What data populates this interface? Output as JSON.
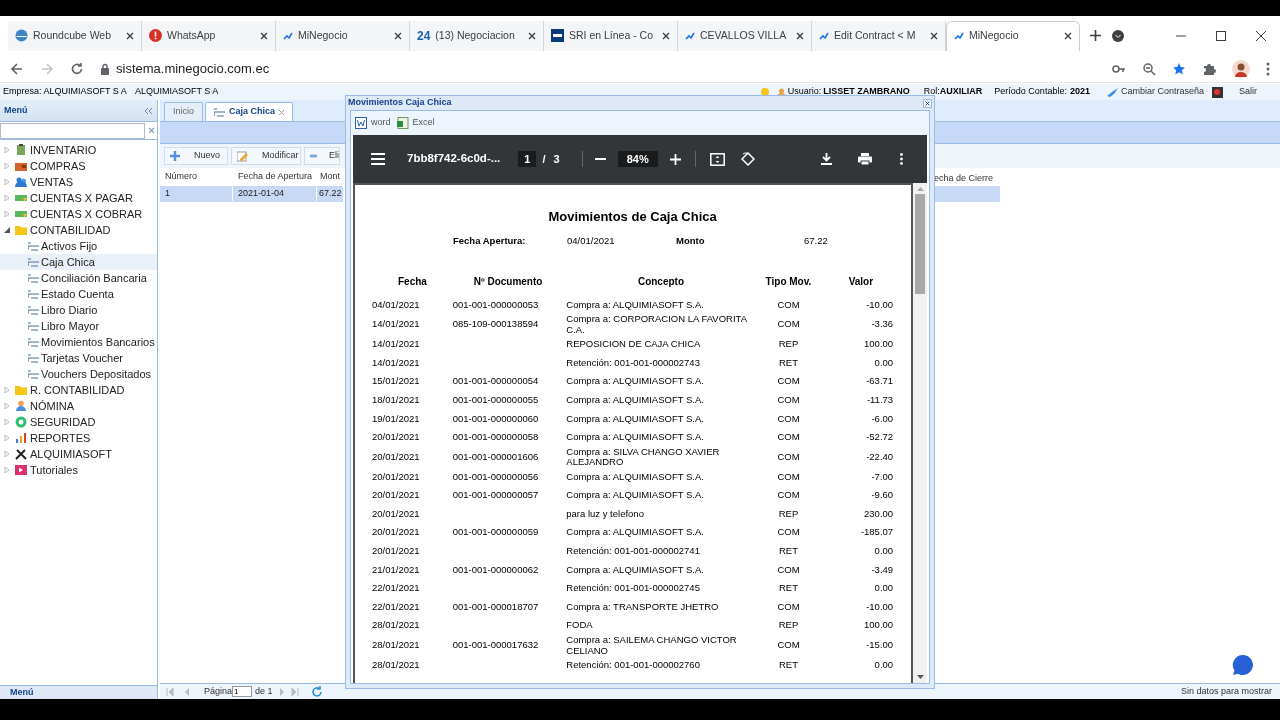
{
  "browser": {
    "tabs": [
      {
        "title": "Roundcube Web",
        "selected": false
      },
      {
        "title": "WhatsApp",
        "selected": false
      },
      {
        "title": "MiNegocio",
        "selected": false
      },
      {
        "title": "(13) Negociacion",
        "icon_text": "24",
        "selected": false
      },
      {
        "title": "SRI en Línea - Co",
        "selected": false
      },
      {
        "title": "CEVALLOS VILLA",
        "selected": false
      },
      {
        "title": "Edit Contract < M",
        "selected": false
      },
      {
        "title": "MiNegocio",
        "selected": true
      }
    ],
    "url": "sistema.minegocio.com.ec"
  },
  "app_header": {
    "company_label": "Empresa:",
    "company": "ALQUIMIASOFT S A",
    "company_2": "ALQUIMIASOFT S A",
    "user_label": "Usuario:",
    "user": "LISSET ZAMBRANO",
    "role_label": "Rol:",
    "role": "AUXILIAR",
    "period_label": "Período Contable:",
    "period": "2021",
    "change_password": "Cambiar Contraseña",
    "logout": "Salir"
  },
  "sidebar": {
    "title": "Menú",
    "collapsed_label": "Menú",
    "items": [
      {
        "label": "INVENTARIO",
        "expanded": false
      },
      {
        "label": "COMPRAS",
        "expanded": false
      },
      {
        "label": "VENTAS",
        "expanded": false
      },
      {
        "label": "CUENTAS X PAGAR",
        "expanded": false
      },
      {
        "label": "CUENTAS X COBRAR",
        "expanded": false
      },
      {
        "label": "CONTABILIDAD",
        "expanded": true,
        "children": [
          {
            "label": "Activos Fijo",
            "selected": false
          },
          {
            "label": "Caja Chica",
            "selected": true
          },
          {
            "label": "Conciliación Bancaria",
            "selected": false
          },
          {
            "label": "Estado Cuenta",
            "selected": false
          },
          {
            "label": "Libro Diario",
            "selected": false
          },
          {
            "label": "Libro Mayor",
            "selected": false
          },
          {
            "label": "Movimientos Bancarios",
            "selected": false
          },
          {
            "label": "Tarjetas Voucher",
            "selected": false
          },
          {
            "label": "Vouchers Depositados",
            "selected": false
          }
        ]
      },
      {
        "label": "R. CONTABILIDAD",
        "expanded": false
      },
      {
        "label": "NÓMINA",
        "expanded": false
      },
      {
        "label": "SEGURIDAD",
        "expanded": false
      },
      {
        "label": "REPORTES",
        "expanded": false
      },
      {
        "label": "ALQUIMIASOFT",
        "expanded": false
      },
      {
        "label": "Tutoriales",
        "expanded": false
      }
    ]
  },
  "main": {
    "tabs": [
      {
        "label": "Inicio",
        "selected": false,
        "closable": false
      },
      {
        "label": "Caja Chica",
        "selected": true,
        "closable": true
      }
    ],
    "toolbar": [
      "Nuevo",
      "Modificar",
      "Eli"
    ],
    "grid": {
      "columns": [
        "Número",
        "Fecha de Apertura",
        "Mont"
      ],
      "rows": [
        {
          "cells": [
            "1",
            "2021-01-04",
            "67.22"
          ],
          "selected": true
        }
      ]
    },
    "column_tail": "echa de Cierre",
    "pager": {
      "label": "Página",
      "page": "1",
      "of": "de 1"
    },
    "empty_message": "Sin datos para mostrar"
  },
  "dialog": {
    "title": "Movimientos Caja Chica",
    "exports": [
      {
        "label": "word",
        "kind": "word"
      },
      {
        "label": "Excel",
        "kind": "excel"
      }
    ],
    "viewer": {
      "file": "7bb8f742-6c0d-...",
      "page": "1",
      "separator": "/",
      "page_total": "3",
      "zoom": "84%"
    },
    "report": {
      "title": "Movimientos de Caja Chica",
      "opening_label": "Fecha Apertura:",
      "opening_date": "04/01/2021",
      "amount_label": "Monto",
      "amount": "67.22",
      "columns": [
        "Fecha",
        "Nº Documento",
        "Concepto",
        "Tipo Mov.",
        "Valor"
      ],
      "rows": [
        [
          "04/01/2021",
          "001-001-000000053",
          "Compra a: ALQUIMIASOFT S.A.",
          "COM",
          "-10.00"
        ],
        [
          "14/01/2021",
          "085-109-000138594",
          "Compra a: CORPORACION LA FAVORITA C.A.",
          "COM",
          "-3.36"
        ],
        [
          "14/01/2021",
          "",
          "REPOSICION DE CAJA CHICA",
          "REP",
          "100.00"
        ],
        [
          "14/01/2021",
          "",
          "Retención: 001-001-000002743",
          "RET",
          "0.00"
        ],
        [
          "15/01/2021",
          "001-001-000000054",
          "Compra a: ALQUIMIASOFT S.A.",
          "COM",
          "-63.71"
        ],
        [
          "18/01/2021",
          "001-001-000000055",
          "Compra a: ALQUIMIASOFT S.A.",
          "COM",
          "-11.73"
        ],
        [
          "19/01/2021",
          "001-001-000000060",
          "Compra a: ALQUIMIASOFT S.A.",
          "COM",
          "-6.00"
        ],
        [
          "20/01/2021",
          "001-001-000000058",
          "Compra a: ALQUIMIASOFT S.A.",
          "COM",
          "-52.72"
        ],
        [
          "20/01/2021",
          "001-001-000001606",
          "Compra a: SILVA CHANGO XAVIER ALEJANDRO",
          "COM",
          "-22.40"
        ],
        [
          "20/01/2021",
          "001-001-000000056",
          "Compra a: ALQUIMIASOFT S.A.",
          "COM",
          "-7.00"
        ],
        [
          "20/01/2021",
          "001-001-000000057",
          "Compra a: ALQUIMIASOFT S.A.",
          "COM",
          "-9.60"
        ],
        [
          "20/01/2021",
          "",
          "para luz y telefono",
          "REP",
          "230.00"
        ],
        [
          "20/01/2021",
          "001-001-000000059",
          "Compra a: ALQUIMIASOFT S.A.",
          "COM",
          "-185.07"
        ],
        [
          "20/01/2021",
          "",
          "Retención: 001-001-000002741",
          "RET",
          "0.00"
        ],
        [
          "21/01/2021",
          "001-001-000000062",
          "Compra a: ALQUIMIASOFT S.A.",
          "COM",
          "-3.49"
        ],
        [
          "22/01/2021",
          "",
          "Retención: 001-001-000002745",
          "RET",
          "0.00"
        ],
        [
          "22/01/2021",
          "001-001-000018707",
          "Compra a: TRANSPORTE JHETRO",
          "COM",
          "-10.00"
        ],
        [
          "28/01/2021",
          "",
          "FODA",
          "REP",
          "100.00"
        ],
        [
          "28/01/2021",
          "001-001-000017632",
          "Compra a: SAILEMA CHANGO VICTOR CELIANO",
          "COM",
          "-15.00"
        ],
        [
          "28/01/2021",
          "",
          "Retención: 001-001-000002760",
          "RET",
          "0.00"
        ]
      ]
    }
  }
}
